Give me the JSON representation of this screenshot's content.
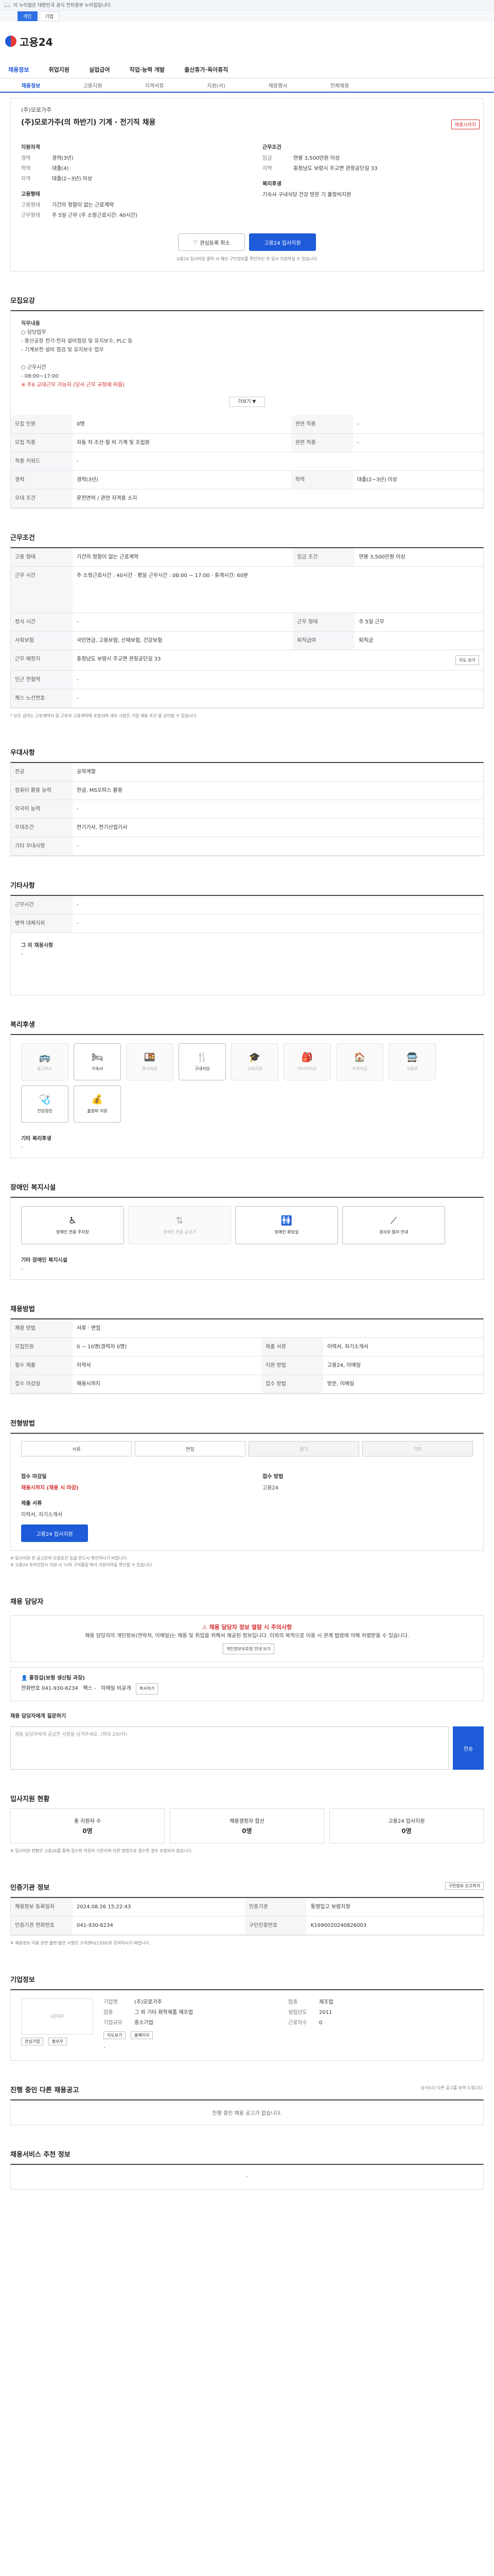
{
  "gov_banner": "이 누리집은 대한민국 공식 전자정부 누리집입니다.",
  "site_switch": [
    "개인",
    "기업"
  ],
  "logo": "고용24",
  "gnb": [
    "채용정보",
    "취업지원",
    "실업급여",
    "직업·능력 개발",
    "출산휴가·육아휴직"
  ],
  "subtabs": [
    "채용정보",
    "고용지원",
    "지역서류",
    "지원(서)",
    "채용행사",
    "전체채용"
  ],
  "job": {
    "company": "(주)모로가주",
    "title": "(주)모로가주(의 하반기) 기계 · 전기직 채용",
    "badge": "채용시까지",
    "left_h": "지원자격",
    "left": [
      {
        "k": "경력",
        "v": "경력(3년)"
      },
      {
        "k": "학력",
        "v": "대졸(4)"
      },
      {
        "k": "자격",
        "v": "대졸(2~3년) 이상"
      }
    ],
    "right_h": "근무조건",
    "right": [
      {
        "k": "임금",
        "v": "연봉 3,500만원 이상"
      },
      {
        "k": "지역",
        "v": "충청남도 보령시 주교면 관창공단길 33"
      }
    ],
    "left2_h": "고용형태",
    "left2": [
      {
        "k": "고용형태",
        "v": "기간의 정함이 없는 근로계약"
      },
      {
        "k": "근무형태",
        "v": "주 5일 근무 (주 소정근로시간: 40시간)"
      }
    ],
    "right2_h": "복리후생",
    "right2": "기숙사  구내식당  건강 방문 기 출장비지원",
    "btn_save": "관심등록 취소",
    "btn_apply": "고용24 입사지원",
    "note": "고용24 입사지원 클릭 시 해당 구인정보를 확인하신 후 입사 지원하실 수 있습니다."
  },
  "duty": {
    "heading": "모집요강",
    "lines": [
      "직무내용",
      "○ 담당업무",
      " - 풍산공장 전기·전자 설비점검 및 유지보수, PLC 등",
      " - 기계보전 설비 점검 및 유지보수 업무",
      "",
      "○ 근무시간",
      " - 08:00~17:00",
      "※ 주6 교대근무 가능자 (당사 근무 규정에 따름)"
    ],
    "more": "더보기 ▼",
    "rows": [
      {
        "k": "모집 인원",
        "v": "0명",
        "k2": "관련 직종",
        "v2": "-"
      },
      {
        "k": "모집 직종",
        "v": "자동 차·조선·철 비 기계 및 조립원",
        "k2": "관련 직종",
        "v2": "-"
      },
      {
        "k": "직종 키워드",
        "v": "-",
        "k2": "",
        "v2": ""
      },
      {
        "k": "경력",
        "v": "경력(3년)",
        "k2": "학력",
        "v2": "대졸(2~3년) 이상"
      },
      {
        "k": "우대 조건",
        "v": "운전면허 / 관련 자격증 소지",
        "k2": "",
        "v2": ""
      }
    ]
  },
  "workcond": {
    "heading": "근무조건",
    "rows": [
      {
        "k": "고용 형태",
        "v": "기간의 정함이 없는 근로계약",
        "k2": "임금 조건",
        "v2": "연봉 3,500만원 이상"
      },
      {
        "k": "근무 시간",
        "v": "주 소정근로시간 : 40시간  ·  평일 근무시간 : 08:00 ~ 17:00  ·  휴게시간: 60분",
        "k2": "",
        "v2": ""
      },
      {
        "k": "정식 시간",
        "v": "-",
        "k2": "근무 형태",
        "v2": "주 5일 근무"
      },
      {
        "k": "사회보험",
        "v": "국민연금, 고용보험, 산재보험, 건강보험",
        "k2": "퇴직급여",
        "v2": "퇴직금"
      },
      {
        "k": "근무 예정지",
        "v": "충청남도 보령시 주교면 관창공단길 33",
        "k2": "",
        "v2": ""
      },
      {
        "k": "인근 전철역",
        "v": "-",
        "k2": "",
        "v2": ""
      },
      {
        "k": "채스 노선번호",
        "v": "-",
        "k2": "",
        "v2": ""
      }
    ],
    "mapbtn": "지도 보기",
    "note": "* 모든 급여는 근로계약서 및 근로자 고용계약에 포함되며 세부 사항은 기업 채용 조건 중 상이할 수 있습니다."
  },
  "prefer": {
    "heading": "우대사항",
    "rows": [
      {
        "k": "전공",
        "v": "공학계열"
      },
      {
        "k": "컴퓨터 활용 능력",
        "v": "한글, MS오피스 활용"
      },
      {
        "k": "외국어 능력",
        "v": "-"
      },
      {
        "k": "우대조건",
        "v": "전기기사, 전기산업기사"
      },
      {
        "k": "기타 우대사항",
        "v": "-"
      }
    ]
  },
  "etc": {
    "heading": "기타사항",
    "rows": [
      {
        "k": "근무시간",
        "v": "-"
      },
      {
        "k": "병역 대체지위",
        "v": "-"
      }
    ],
    "box_h": "그 외 채용사항",
    "box_v": "-"
  },
  "welfare": {
    "heading": "복리후생",
    "items": [
      {
        "icon": "car-icon",
        "label": "통근버스",
        "on": false
      },
      {
        "icon": "bed-icon",
        "label": "기숙사",
        "on": true
      },
      {
        "icon": "food-icon",
        "label": "중식제공",
        "on": false
      },
      {
        "icon": "cafe-icon",
        "label": "구내식당",
        "on": true
      },
      {
        "icon": "gift-icon",
        "label": "교육지원",
        "on": false
      },
      {
        "icon": "grad-icon",
        "label": "자녀학자금",
        "on": false
      },
      {
        "icon": "home-icon",
        "label": "주택자금",
        "on": false
      },
      {
        "icon": "bus-icon",
        "label": "교통비",
        "on": false
      },
      {
        "icon": "doctor-icon",
        "label": "건강검진",
        "on": true
      },
      {
        "icon": "coin-icon",
        "label": "출장비 지원",
        "on": true
      }
    ],
    "etc_h": "기타 복리후생",
    "etc_v": "-"
  },
  "disabled": {
    "heading": "장애인 복지시설",
    "items": [
      {
        "label": "장애인 전용 주차장",
        "on": true
      },
      {
        "label": "장애인 전용 승강기",
        "on": false
      },
      {
        "label": "장애인 화장실",
        "on": true
      },
      {
        "label": "경사로·점자 안내",
        "on": true
      }
    ],
    "etc_h": "기타 장애인 복지시설",
    "etc_v": "-"
  },
  "apply": {
    "heading": "채용방법",
    "rows": [
      {
        "k": "채용 방법",
        "v": "서류 · 면접",
        "k2": "",
        "v2": ""
      },
      {
        "k": "모집인원",
        "v": "0 ~ 10명(경력자 0명)",
        "k2": "제출 서류",
        "v2": "이력서, 자기소개서"
      },
      {
        "k": "필수 제출",
        "v": "이력서",
        "k2": "지원 방법",
        "v2": "고용24, 이메일"
      },
      {
        "k": "접수 마감일",
        "v": "채용시까지",
        "k2": "접수 방법",
        "v2": "방문, 이메일"
      },
      {
        "k": "",
        "v": "",
        "k2": "",
        "v2": ""
      }
    ]
  },
  "process": {
    "heading": "전형방법",
    "steps": [
      {
        "label": "서류",
        "on": true
      },
      {
        "label": "면접",
        "on": true
      },
      {
        "label": "필기",
        "on": false
      },
      {
        "label": "기타",
        "on": false
      }
    ],
    "left_h": "접수 마감일",
    "left_v": "채용시까지 (채용 시 마감)",
    "right_h": "접수 방법",
    "right_v": "고용24",
    "docs_h": "제출 서류",
    "docs_v": "이력서, 자기소개서",
    "btn": "고용24 입사지원",
    "notes": [
      "※ 입사지원 전 공고문의 모집조건 등을 반드시 확인하시기 바랍니다.",
      "※ 고용24 온라인입사 지원 시 '나의 구직활동'에서 지원이력을 확인할 수 있습니다."
    ]
  },
  "contact": {
    "heading": "채용 담당자",
    "alert_t": "채용 담당자 정보 열람 시 주의사항",
    "alert": "채용 담당자의 개인정보(연락처, 이메일)는 채용 및 취업을 위해서 제공된 정보입니다. 이외의 목적으로 이용 시 관계 법령에 의해 처벌받을 수 있습니다.",
    "agree_btn": "개인정보보호법 안내 보기",
    "person": "홍정섭(보령 생산팀 과장)",
    "tel_label": "전화번호",
    "tel": "041-930-6234",
    "fax_label": "팩스",
    "fax": "-",
    "email_label": "이메일",
    "email": "비공개",
    "copy_btn": "복사하기",
    "msg_h": "채용 담당자에게 질문하기",
    "msg_ph": "채용 담당자에게 궁금한 사항을 남겨주세요. (최대 200자)",
    "send": "전송"
  },
  "stats": {
    "heading": "입사지원 현황",
    "items": [
      {
        "label": "총 지원자 수",
        "value": "0명"
      },
      {
        "label": "채용결정자 합산",
        "value": "0명"
      },
      {
        "label": "고용24 입사지원",
        "value": "0명"
      }
    ],
    "note": "※ 입사지원 현황은 고용24를 통해 접수한 지원자 기준이며 다른 방법으로 접수한 경우 포함되지 않습니다."
  },
  "info": {
    "heading": "인증기관 정보",
    "rows": [
      {
        "k": "채용정보 등록일자",
        "v": "2024.08.26 15:22:43",
        "k2": "인증기관",
        "v2": "통영입고 보령지청"
      },
      {
        "k": "인증기관 전화번호",
        "v": "041-930-6234",
        "k2": "구인인증번호",
        "v2": "K1690020240826003"
      }
    ],
    "btn": "구인정보 신고하기",
    "note": "※ 채용정보 이용 관련 불편·불만 사항은 고객센터(1350)로 문의하시기 바랍니다."
  },
  "company": {
    "heading": "기업정보",
    "logo_alt": "LOGO",
    "rows": [
      {
        "k": "기업명",
        "v": "(주)모로가주",
        "k2": "업종",
        "v2": "제조업"
      },
      {
        "k": "업종",
        "v": "그 외 기타 화학제품 제조업",
        "k2": "설립년도",
        "v2": "2011"
      },
      {
        "k": "기업규모",
        "v": "중소기업",
        "k2": "근로자수",
        "v2": "0"
      }
    ],
    "map_btn": "지도보기",
    "homepage_btn": "홈페이지",
    "interest_btn": "관심기업",
    "follow_btn": "팔로우",
    "desc": "-"
  },
  "others": {
    "heading": "진행 중인 다른 채용공고",
    "empty": "진행 중인 채용 공고가 없습니다.",
    "note": "당사(나) 다른 공고를 보여 드립니다."
  },
  "recommend": {
    "heading": "채용서비스 추천 정보",
    "item": "-"
  }
}
